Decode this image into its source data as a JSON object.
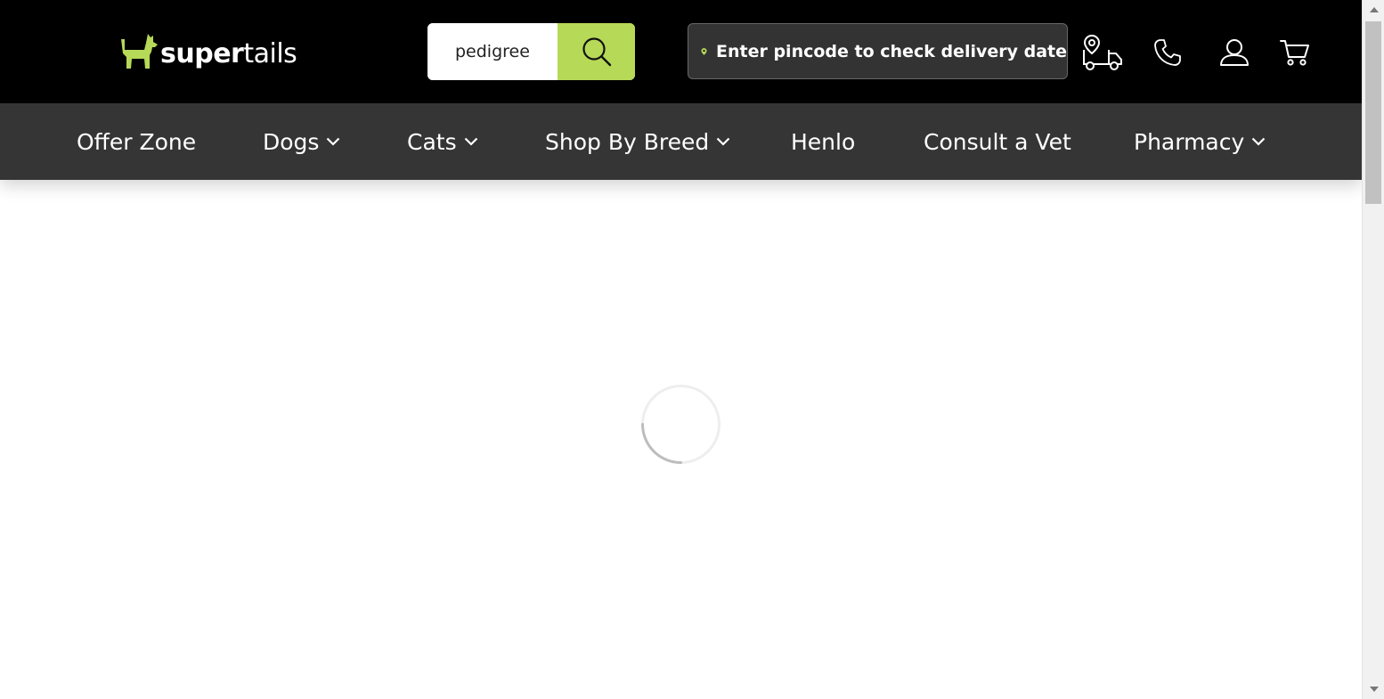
{
  "header": {
    "logo": {
      "bold": "super",
      "light": "tails"
    },
    "search": {
      "value": "pedigree",
      "icon": "search-icon"
    },
    "pincode": {
      "label": "Enter pincode to check delivery date",
      "icon": "location-pin-icon",
      "accent": "#b6d957"
    },
    "icons": [
      "delivery-truck-icon",
      "phone-icon",
      "user-icon",
      "cart-icon"
    ]
  },
  "nav": {
    "items": [
      {
        "label": "Offer Zone",
        "dropdown": false
      },
      {
        "label": "Dogs",
        "dropdown": true
      },
      {
        "label": "Cats",
        "dropdown": true
      },
      {
        "label": "Shop By Breed",
        "dropdown": true
      },
      {
        "label": "Henlo",
        "dropdown": false
      },
      {
        "label": "Consult a Vet",
        "dropdown": false
      },
      {
        "label": "Pharmacy",
        "dropdown": true
      }
    ]
  },
  "main": {
    "state": "loading"
  },
  "colors": {
    "header_bg": "#000000",
    "nav_bg": "#353535",
    "brand_green": "#b6d957"
  }
}
